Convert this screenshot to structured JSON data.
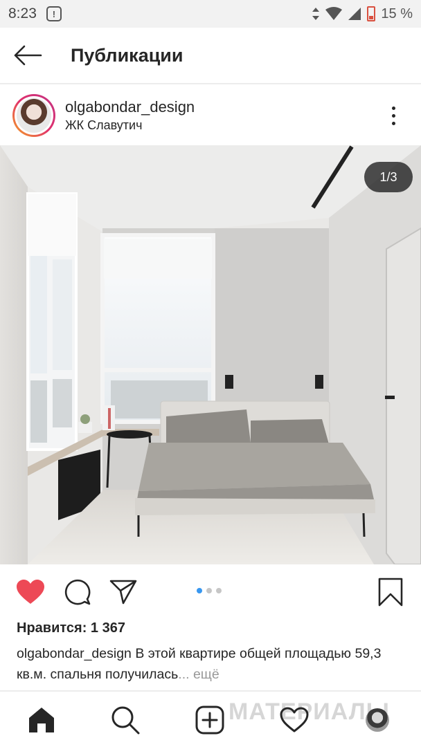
{
  "status_bar": {
    "time": "8:23",
    "battery_percent": "15 %",
    "battery_level": 0.15
  },
  "header": {
    "title": "Публикации",
    "back_icon": "arrow-left-icon"
  },
  "post": {
    "username": "olgabondar_design",
    "location": "ЖК Славутич",
    "photo_counter": "1/3",
    "carousel": {
      "current": 1,
      "total": 3
    },
    "likes_text": "Нравится: 1 367",
    "caption_user": "olgabondar_design",
    "caption_text": "В этой квартире общей площадью 59,3 кв.м.  спальня получилась",
    "more_label": "... ещё"
  },
  "bottom_nav": {
    "items": [
      "home-icon",
      "search-icon",
      "add-post-icon",
      "heart-icon",
      "profile-avatar"
    ],
    "watermark": "МАТЕРИАЛЫ"
  },
  "colors": {
    "like": "#ed4956",
    "dot_active": "#3897f0",
    "text": "#262626"
  }
}
